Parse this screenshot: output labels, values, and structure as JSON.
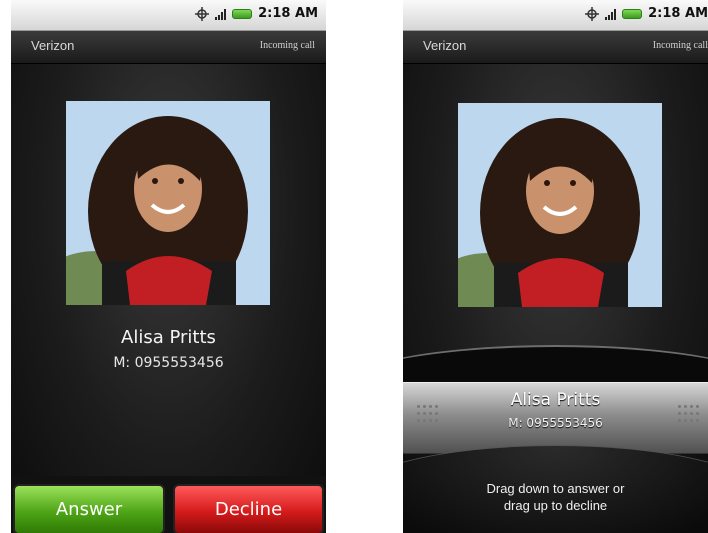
{
  "screens": [
    {
      "status_time": "2:18 AM",
      "carrier": "Verizon",
      "call_state": "Incoming call",
      "caller": {
        "name": "Alisa Pritts",
        "number": "M: 0955553456"
      },
      "buttons": {
        "answer_label": "Answer",
        "decline_label": "Decline"
      }
    },
    {
      "status_time": "2:18 AM",
      "carrier": "Verizon",
      "call_state": "Incoming call",
      "caller": {
        "name": "Alisa Pritts",
        "number": "M: 0955553456"
      },
      "hint": {
        "line1": "Drag down to answer or",
        "line2": "drag up to decline"
      }
    }
  ],
  "colors": {
    "answer": "#4ea516",
    "decline": "#d51b1b",
    "background": "#0d0d0d"
  },
  "icons": [
    "gps-icon",
    "signal-icon",
    "battery-icon"
  ]
}
